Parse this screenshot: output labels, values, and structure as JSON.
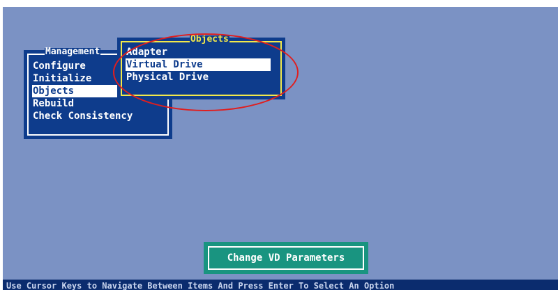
{
  "management_menu": {
    "title": "Management",
    "items": [
      {
        "label": "Configure"
      },
      {
        "label": "Initialize"
      },
      {
        "label": "Objects",
        "selected": true
      },
      {
        "label": "Rebuild"
      },
      {
        "label": "Check Consistency"
      }
    ]
  },
  "objects_menu": {
    "title": "Objects",
    "items": [
      {
        "label": "Adapter"
      },
      {
        "label": "Virtual Drive",
        "selected": true
      },
      {
        "label": "Physical Drive"
      }
    ]
  },
  "action": {
    "label": "Change VD Parameters"
  },
  "status_bar": {
    "text": "Use Cursor Keys to Navigate Between Items And Press Enter To Select An Option"
  },
  "colors": {
    "screen_background": "#7b92c4",
    "menu_background": "#0e3c8c",
    "active_menu_border": "#f2e84a",
    "highlight_circle": "#e01e1e",
    "action_panel": "#199480",
    "status_bar": "#0b2c6e"
  }
}
